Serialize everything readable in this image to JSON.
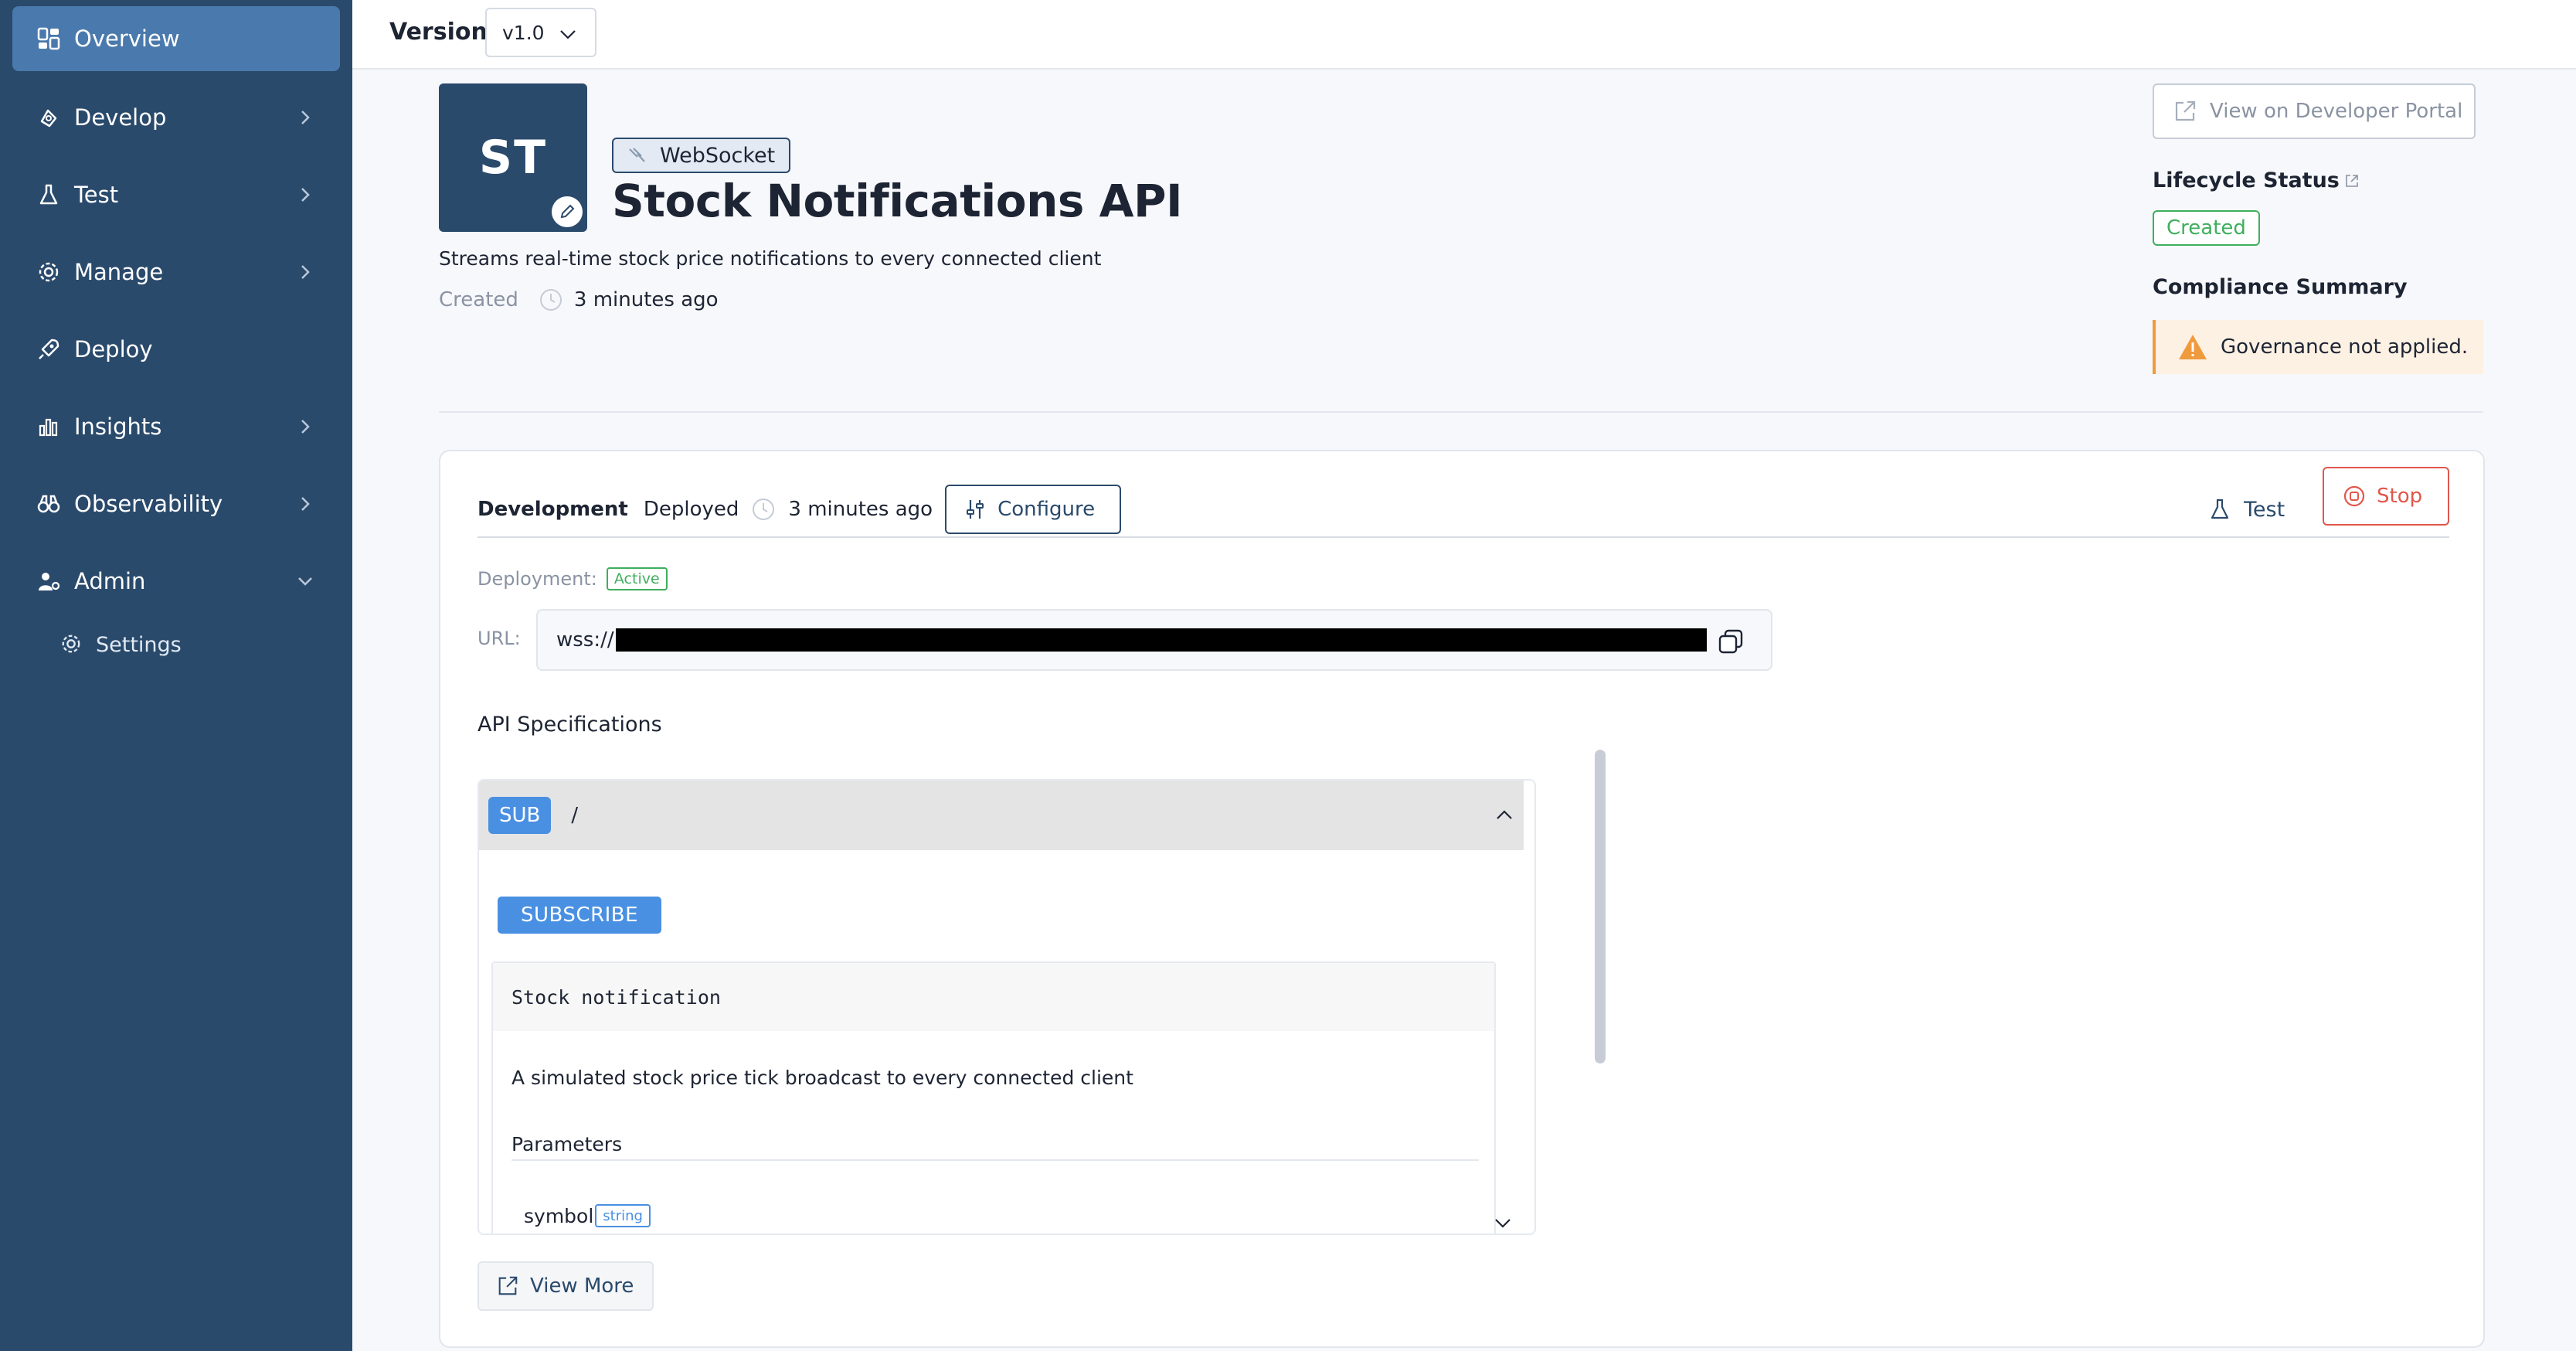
{
  "sidebar": {
    "items": [
      {
        "label": "Overview",
        "icon": "overview-icon"
      },
      {
        "label": "Develop",
        "icon": "develop-icon"
      },
      {
        "label": "Test",
        "icon": "flask-icon"
      },
      {
        "label": "Manage",
        "icon": "gear-icon"
      },
      {
        "label": "Deploy",
        "icon": "rocket-icon"
      },
      {
        "label": "Insights",
        "icon": "bar-chart-icon"
      },
      {
        "label": "Observability",
        "icon": "binoculars-icon"
      },
      {
        "label": "Admin",
        "icon": "users-gear-icon"
      }
    ],
    "sub_items": [
      {
        "label": "Settings",
        "icon": "gear-icon"
      }
    ]
  },
  "topbar": {
    "version_label": "Version",
    "version_value": "v1.0"
  },
  "api": {
    "avatar_initials": "ST",
    "type_tag": "WebSocket",
    "title": "Stock Notifications API",
    "description": "Streams real-time stock price notifications to every connected client",
    "created_label": "Created",
    "created_time": "3 minutes ago"
  },
  "right_panel": {
    "portal_button": "View on Developer Portal",
    "lifecycle_label": "Lifecycle Status",
    "lifecycle_status": "Created",
    "compliance_label": "Compliance Summary",
    "governance_warning": "Governance not applied."
  },
  "development": {
    "title": "Development",
    "state": "Deployed",
    "time": "3 minutes ago",
    "configure_button": "Configure",
    "test_button": "Test",
    "stop_button": "Stop",
    "deployment_label": "Deployment:",
    "deployment_status": "Active",
    "url_label": "URL:",
    "url_prefix": "wss://"
  },
  "spec": {
    "title": "API Specifications",
    "operation_method": "SUB",
    "operation_path": "/",
    "subscribe_button": "SUBSCRIBE",
    "message_name": "Stock notification",
    "message_description": "A simulated stock price tick broadcast to every connected client",
    "parameters_label": "Parameters",
    "parameters": [
      {
        "name": "symbol",
        "type": "string"
      }
    ],
    "view_more_button": "View More"
  },
  "colors": {
    "sidebar_bg": "#2a4a6c",
    "sidebar_active": "#4a79ad",
    "success": "#3fae5d",
    "danger": "#e2574c",
    "warning": "#f09a3e",
    "accent_blue": "#4990e2"
  }
}
